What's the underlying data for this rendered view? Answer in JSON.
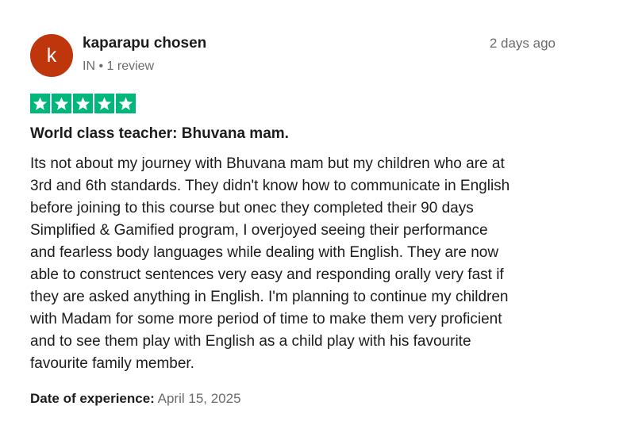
{
  "reviewer": {
    "initial": "k",
    "avatar_color": "#bf360c",
    "name": "kaparapu chosen",
    "country": "IN",
    "separator": "•",
    "reviews_count": "1 review"
  },
  "posted_time": "2 days ago",
  "rating": {
    "value": 5,
    "max": 5,
    "star_color": "#00b67a",
    "icon": "star-icon"
  },
  "review": {
    "title": "World class teacher: Bhuvana mam.",
    "body_lines": [
      "Its not about my journey with Bhuvana mam but my children who are at",
      "3rd and 6th standards. They didn't know how to communicate in English",
      "before joining to this course but onec they completed their 90 days",
      "Simplified & Gamified program, I overjoyed seeing their performance",
      "and fearless body languages while dealing with English. They are now",
      "able to construct sentences very easy and responding orally very fast if",
      "they are asked anything in English. I'm planning to continue my children",
      "with Madam for some more period of time to make them very proficient",
      "and to see them play with English as a child play with his favourite",
      "favourite family member."
    ]
  },
  "experience": {
    "label": "Date of experience:",
    "date": "April 15, 2025"
  }
}
